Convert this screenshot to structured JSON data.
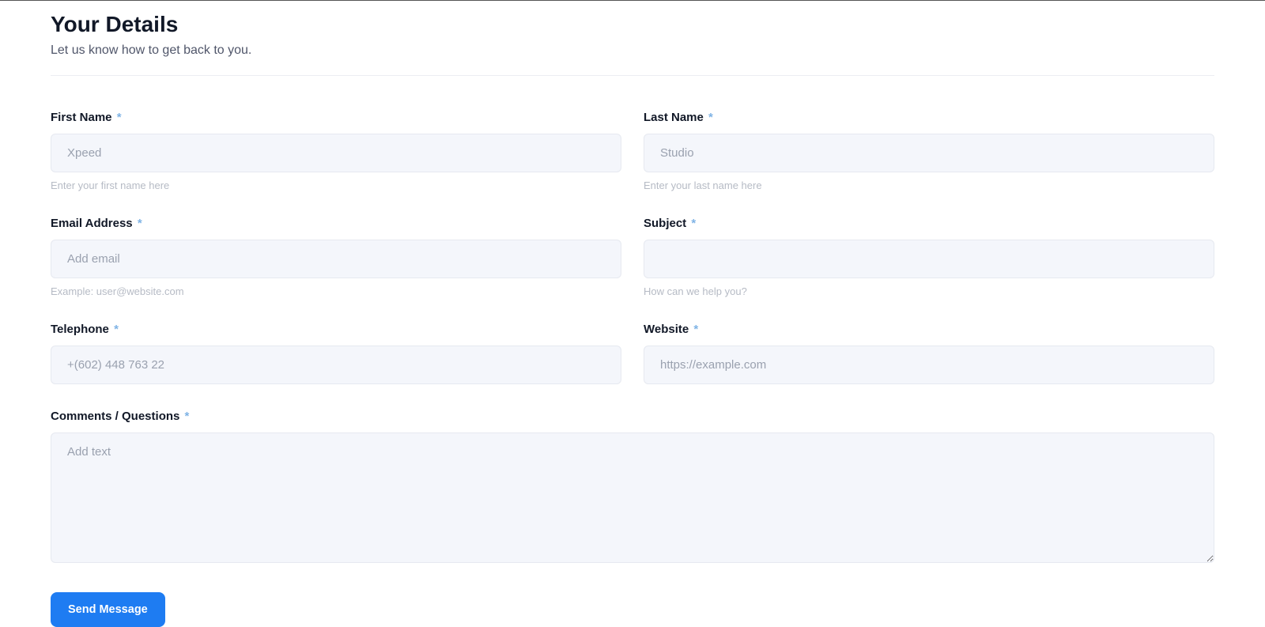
{
  "header": {
    "title": "Your Details",
    "subtitle": "Let us know how to get back to you."
  },
  "fields": {
    "first_name": {
      "label": "First Name",
      "required": "*",
      "placeholder": "Xpeed",
      "help": "Enter your first name here"
    },
    "last_name": {
      "label": "Last Name",
      "required": "*",
      "placeholder": "Studio",
      "help": "Enter your last name here"
    },
    "email": {
      "label": "Email Address",
      "required": "*",
      "placeholder": "Add email",
      "help": "Example: user@website.com"
    },
    "subject": {
      "label": "Subject",
      "required": "*",
      "placeholder": "",
      "help": "How can we help you?"
    },
    "telephone": {
      "label": "Telephone",
      "required": "*",
      "placeholder": "+(602) 448 763 22"
    },
    "website": {
      "label": "Website",
      "required": "*",
      "placeholder": "https://example.com"
    },
    "comments": {
      "label": "Comments / Questions",
      "required": "*",
      "placeholder": "Add text"
    }
  },
  "actions": {
    "submit": "Send Message"
  }
}
